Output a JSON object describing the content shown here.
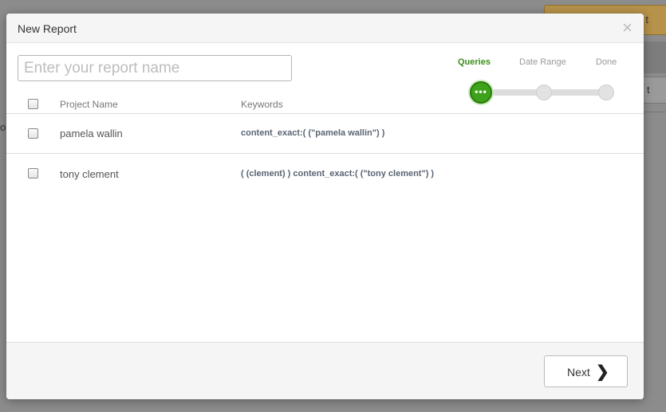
{
  "background": {
    "top_button_label": "t",
    "top_button_mark": "▲",
    "side_button_label": "t",
    "left_text": "or"
  },
  "modal": {
    "title": "New Report",
    "close_label": "×"
  },
  "report_name": {
    "value": "",
    "placeholder": "Enter your report name"
  },
  "steps": [
    {
      "label": "Queries",
      "active": true
    },
    {
      "label": "Date Range",
      "active": false
    },
    {
      "label": "Done",
      "active": false
    }
  ],
  "table": {
    "headers": {
      "name": "Project Name",
      "keywords": "Keywords"
    },
    "rows": [
      {
        "name": "pamela wallin",
        "keywords": "content_exact:( (\"pamela wallin\") )"
      },
      {
        "name": "tony clement",
        "keywords": "( (clement) ) content_exact:( (\"tony clement\") )"
      }
    ]
  },
  "footer": {
    "next_label": "Next",
    "next_icon": "chevron-right-icon"
  },
  "colors": {
    "accent_active_step": "#3ea31a",
    "overlay": "#8a8a8a"
  }
}
